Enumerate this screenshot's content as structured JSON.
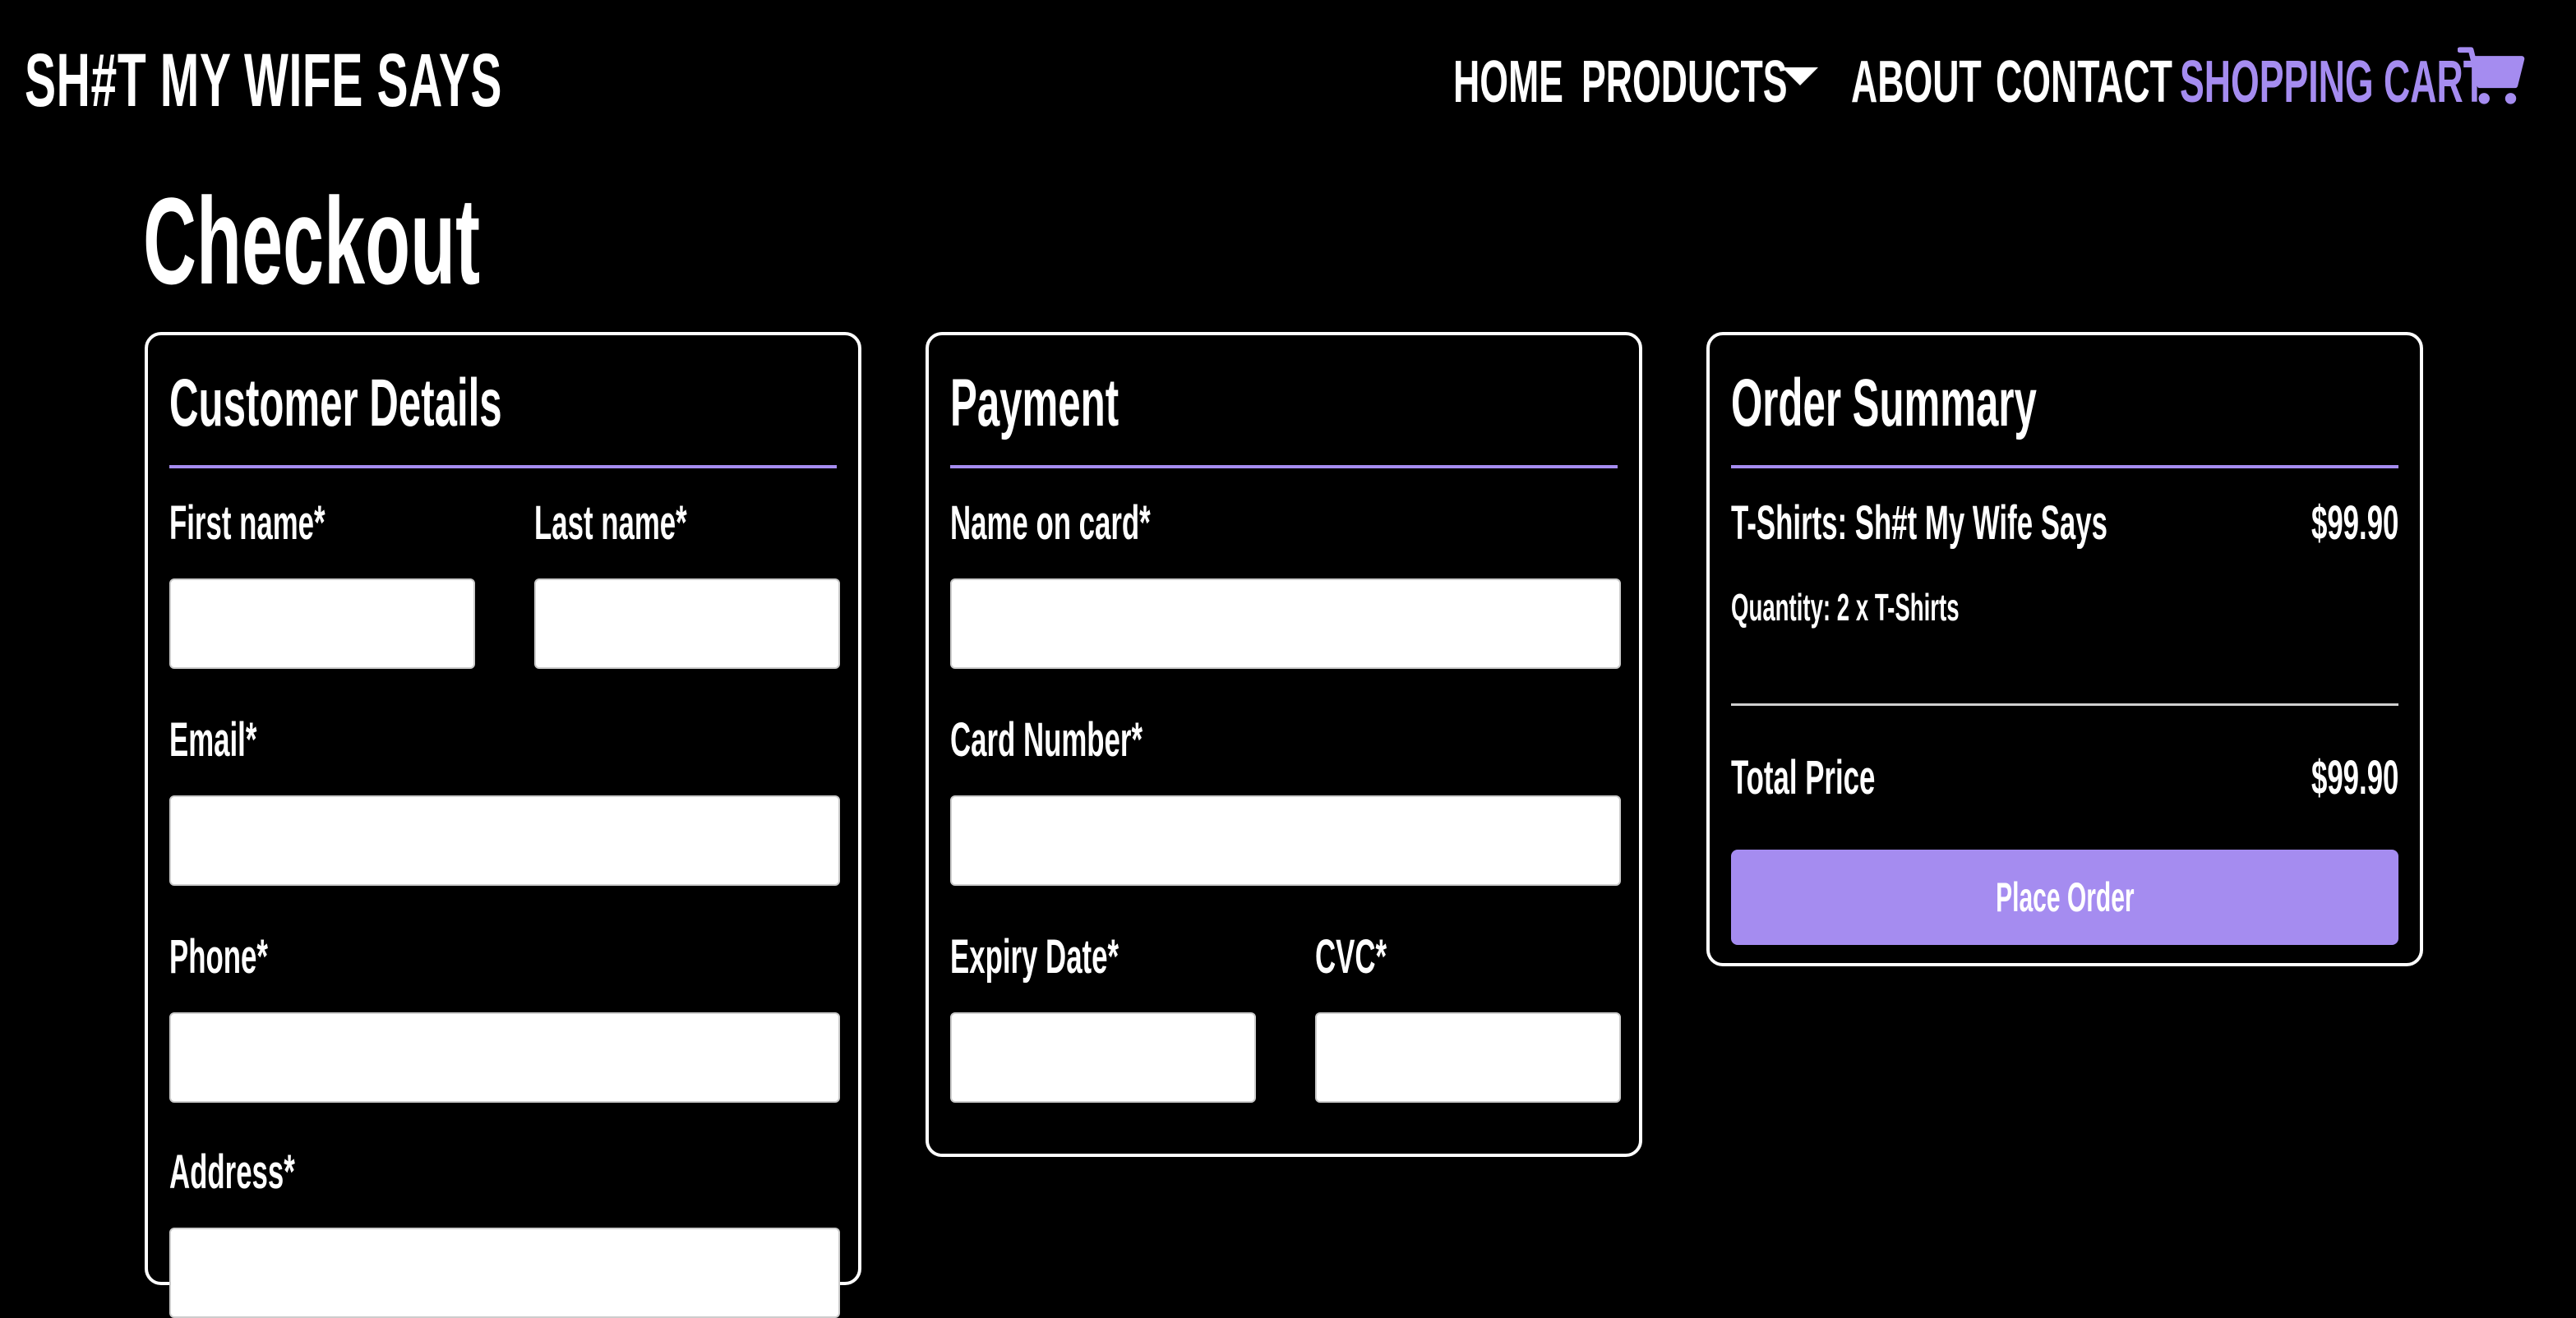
{
  "header": {
    "brand": "SH#T MY WIFE SAYS",
    "nav": {
      "home": "HOME",
      "products": "PRODUCTS",
      "about": "ABOUT",
      "contact": "CONTACT",
      "cart": "SHOPPING CART"
    },
    "cart_icon": "shopping-cart-icon",
    "accent_color": "#a58cf0"
  },
  "page": {
    "title": "Checkout"
  },
  "customer_details": {
    "title": "Customer Details",
    "first_name_label": "First name*",
    "first_name_value": "",
    "last_name_label": "Last name*",
    "last_name_value": "",
    "email_label": "Email*",
    "email_value": "",
    "phone_label": "Phone*",
    "phone_value": "",
    "address_label": "Address*",
    "address_value": ""
  },
  "payment": {
    "title": "Payment",
    "name_on_card_label": "Name on card*",
    "name_on_card_value": "",
    "card_number_label": "Card Number*",
    "card_number_value": "",
    "expiry_label": "Expiry Date*",
    "expiry_value": "",
    "cvc_label": "CVC*",
    "cvc_value": ""
  },
  "order_summary": {
    "title": "Order Summary",
    "item_name": "T-Shirts: Sh#t My Wife Says",
    "item_price": "$99.90",
    "quantity": "Quantity: 2 x T-Shirts",
    "total_label": "Total Price",
    "total_value": "$99.90",
    "place_order_label": "Place Order"
  }
}
